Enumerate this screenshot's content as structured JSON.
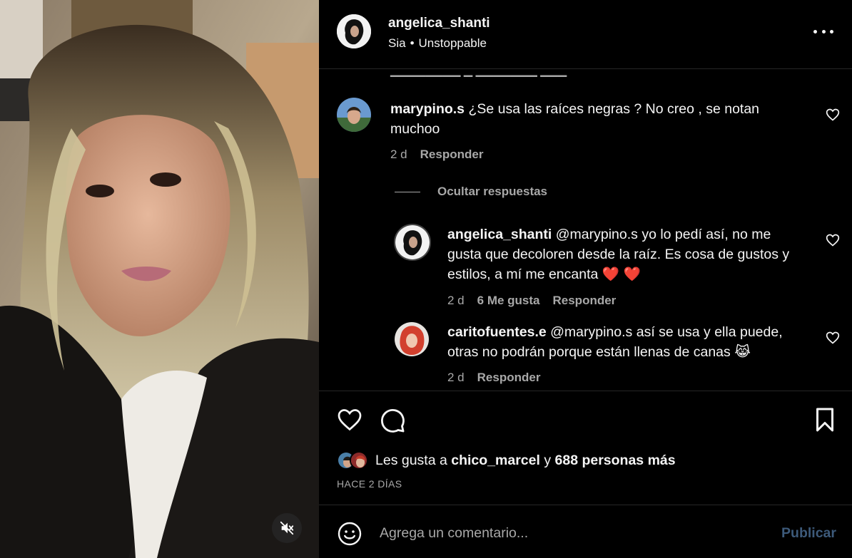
{
  "post": {
    "username": "angelica_shanti",
    "audio": {
      "artist": "Sia",
      "separator": "•",
      "song": "Unstoppable"
    }
  },
  "comments": [
    {
      "username": "marypino.s",
      "text": "¿Se usa las raíces negras ? No creo , se notan muchoo",
      "time": "2 d",
      "reply_label": "Responder"
    }
  ],
  "hide_replies_label": "Ocultar respuestas",
  "replies": [
    {
      "username": "angelica_shanti",
      "mention": "@marypino.s",
      "text_line1": "yo lo pedí así, no me",
      "text_line2": "gusta que decoloren desde la raíz. Es cosa de gustos y",
      "text_line3": "estilos, a mí me encanta ❤️ ❤️",
      "time": "2 d",
      "likes": "6 Me gusta",
      "reply_label": "Responder"
    },
    {
      "username": "caritofuentes.e",
      "mention": "@marypino.s",
      "text_line1": "así se usa y ella puede,",
      "text_line2": "otras no podrán porque están llenas de canas 😹",
      "time": "2 d",
      "reply_label": "Responder"
    }
  ],
  "likes_summary": {
    "prefix": "Les gusta a",
    "user": "chico_marcel",
    "connector": "y",
    "others": "688 personas más"
  },
  "date": "HACE 2 DÍAS",
  "composer": {
    "placeholder": "Agrega un comentario...",
    "publish_label": "Publicar"
  },
  "icons": {
    "more": "more-horizontal-icon",
    "heart": "heart-icon",
    "comment": "comment-icon",
    "bookmark": "bookmark-icon",
    "emoji": "emoji-icon",
    "mute": "speaker-muted-icon"
  },
  "colors": {
    "background": "#000000",
    "text": "#f5f5f5",
    "secondary": "#a8a8a8",
    "divider": "#262626",
    "publish_disabled": "#3d5a7a"
  }
}
